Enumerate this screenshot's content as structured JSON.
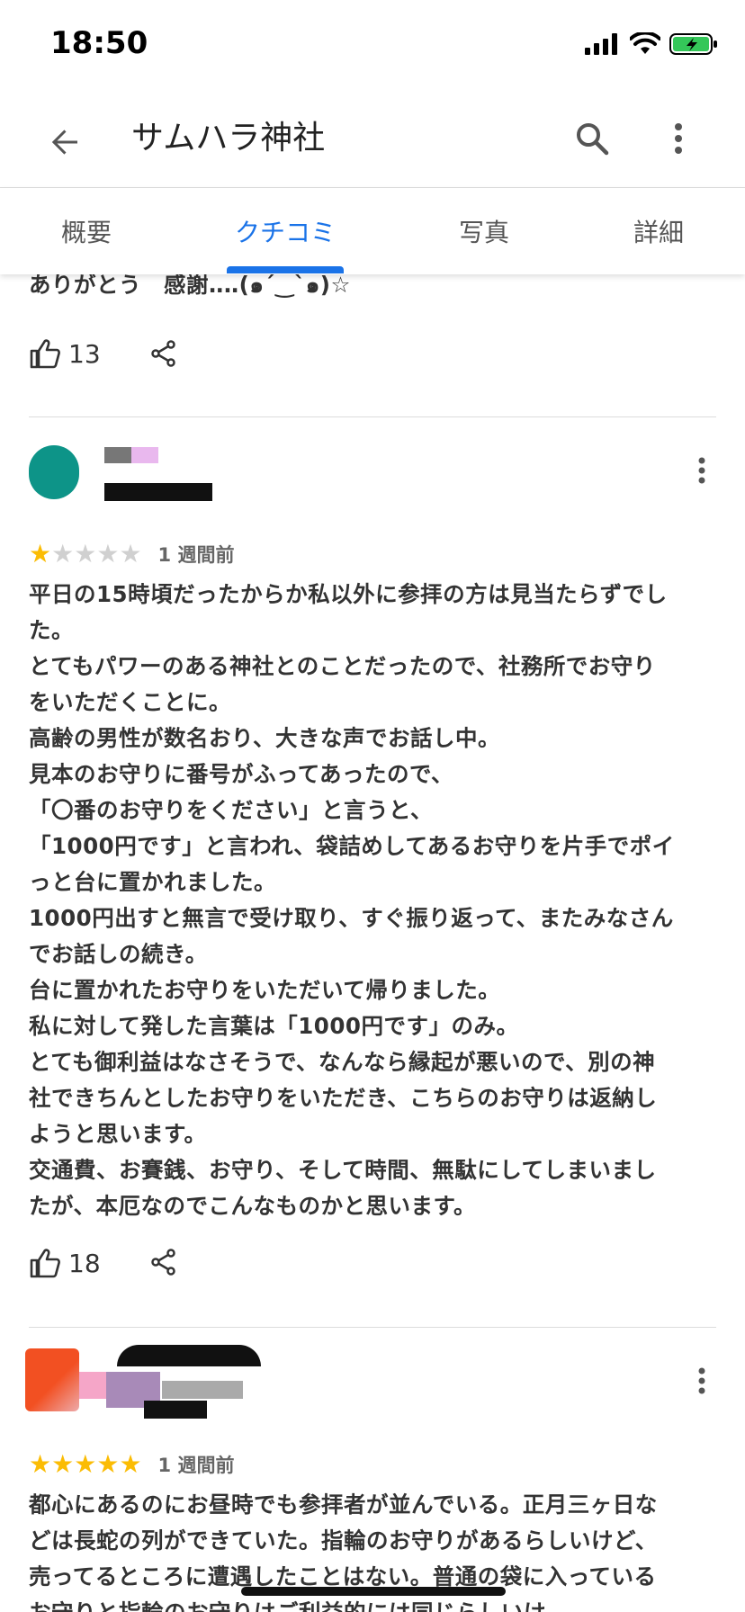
{
  "status": {
    "time": "18:50"
  },
  "header": {
    "title": "サムハラ神社"
  },
  "tabs": [
    {
      "label": "概要"
    },
    {
      "label": "クチコミ"
    },
    {
      "label": "写真"
    },
    {
      "label": "詳細"
    }
  ],
  "active_tab": "クチコミ",
  "reviews": [
    {
      "text": "ありがとう　感謝‥‥(๑´‿`๑)☆",
      "likes": "13"
    },
    {
      "rating": 1,
      "time": "1 週間前",
      "text": "平日の15時頃だったからか私以外に参拝の方は見当たらずでした。\nとてもパワーのある神社とのことだったので、社務所でお守りをいただくことに。\n高齢の男性が数名おり、大きな声でお話し中。\n見本のお守りに番号がふってあったので、\n「〇番のお守りをください」と言うと、\n「1000円です」と言われ、袋詰めしてあるお守りを片手でポイっと台に置かれました。\n1000円出すと無言で受け取り、すぐ振り返って、またみなさんでお話しの続き。\n台に置かれたお守りをいただいて帰りました。\n私に対して発した言葉は「1000円です」のみ。\nとても御利益はなさそうで、なんなら縁起が悪いので、別の神社できちんとしたお守りをいただき、こちらのお守りは返納しようと思います。\n交通費、お賽銭、お守り、そして時間、無駄にしてしまいましたが、本厄なのでこんなものかと思います。",
      "likes": "18"
    },
    {
      "rating": 5,
      "time": "1 週間前",
      "text": "都心にあるのにお昼時でも参拝者が並んでいる。正月三ヶ日などは長蛇の列ができていた。指輪のお守りがあるらしいけど、売ってるところに遭遇したことはない。普通の袋に入っているお守りと指輪のお守りはご利益的には同じらしいけ"
    }
  ],
  "colors": {
    "accent": "#1a73e8",
    "star": "#fbbc04",
    "star_off": "#d0d0d0"
  }
}
